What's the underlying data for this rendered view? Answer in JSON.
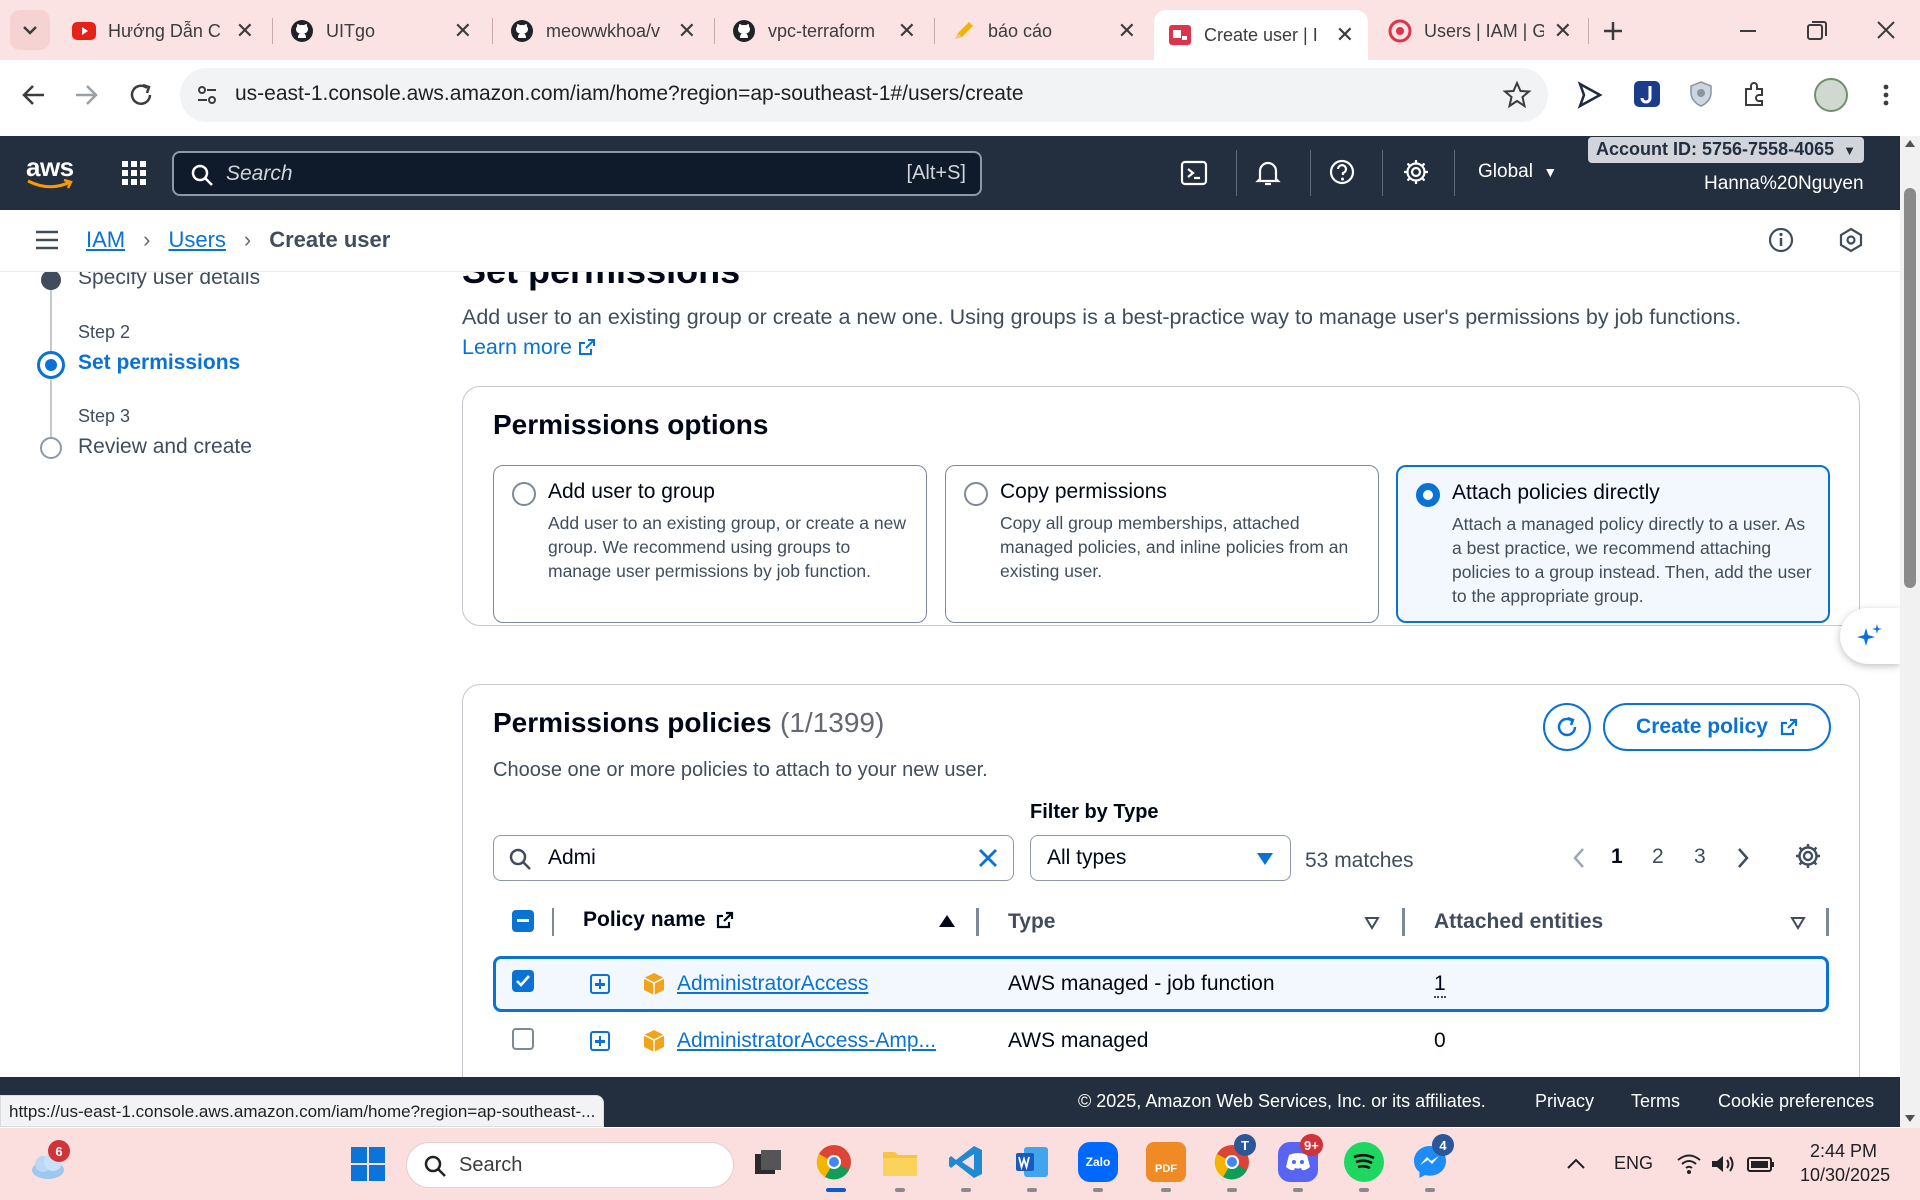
{
  "browser": {
    "tabs": [
      {
        "title": "Hướng Dẫn C",
        "icon": "youtube-icon"
      },
      {
        "title": "UITgo",
        "icon": "github-icon"
      },
      {
        "title": "meowwkhoa/v",
        "icon": "github-icon"
      },
      {
        "title": "vpc-terraform",
        "icon": "github-icon"
      },
      {
        "title": "báo cáo",
        "icon": "pencil-icon"
      },
      {
        "title": "Create user | I",
        "icon": "aws-console-icon"
      },
      {
        "title": "Users | IAM | G",
        "icon": "aws-console-icon"
      }
    ],
    "url": "us-east-1.console.aws.amazon.com/iam/home?region=ap-southeast-1#/users/create",
    "status_url": "https://us-east-1.console.aws.amazon.com/iam/home?region=ap-southeast-..."
  },
  "awsnav": {
    "logo": "aws",
    "search_placeholder": "Search",
    "search_shortcut": "[Alt+S]",
    "region": "Global",
    "account": "Account ID: 5756-7558-4065",
    "user": "Hanna%20Nguyen"
  },
  "breadcrumb": {
    "iam": "IAM",
    "users": "Users",
    "current": "Create user"
  },
  "steps": {
    "step1_name": "Specify user details",
    "step2_label": "Step 2",
    "step2_name": "Set permissions",
    "step3_label": "Step 3",
    "step3_name": "Review and create"
  },
  "page": {
    "title": "Set permissions",
    "intro": "Add user to an existing group or create a new one. Using groups is a best-practice way to manage user's permissions by job functions.",
    "learn": "Learn",
    "more": "more"
  },
  "options": {
    "heading": "Permissions options",
    "items": [
      {
        "title": "Add user to group",
        "desc": "Add user to an existing group, or create a new group. We recommend using groups to manage user permissions by job function."
      },
      {
        "title": "Copy permissions",
        "desc": "Copy all group memberships, attached managed policies, and inline policies from an existing user."
      },
      {
        "title": "Attach policies directly",
        "desc": "Attach a managed policy directly to a user. As a best practice, we recommend attaching policies to a group instead. Then, add the user to the appropriate group."
      }
    ],
    "selected_index": 2
  },
  "policies": {
    "heading": "Permissions policies",
    "count": "(1/1399)",
    "subtitle": "Choose one or more policies to attach to your new user.",
    "create_button": "Create policy",
    "search_value": "Admi",
    "filter_label": "Filter by Type",
    "filter_value": "All types",
    "matches": "53 matches",
    "pages": [
      "1",
      "2",
      "3"
    ],
    "current_page": "1",
    "columns": [
      "Policy name",
      "Type",
      "Attached entities"
    ],
    "rows": [
      {
        "name": "AdministratorAccess",
        "type": "AWS managed - job function",
        "entities": "1",
        "checked": true
      },
      {
        "name": "AdministratorAccess-Amp...",
        "type": "AWS managed",
        "entities": "0",
        "checked": false
      }
    ]
  },
  "footer": {
    "copyright": "© 2025, Amazon Web Services, Inc. or its affiliates.",
    "privacy": "Privacy",
    "terms": "Terms",
    "cookies": "Cookie preferences"
  },
  "taskbar": {
    "search": "Search",
    "weather_badge": "6",
    "teams_badge": "T",
    "discord_badge": "9+",
    "messenger_badge": "4",
    "lang": "ENG",
    "time": "2:44 PM",
    "date": "10/30/2025",
    "zalo_label": "Zalo",
    "pdf_label": "PDF"
  },
  "colors": {
    "accent": "#0972d3",
    "aws_nav": "#232f3e",
    "tabstrip": "#fbe3e3",
    "taskbar": "#fbdede"
  }
}
